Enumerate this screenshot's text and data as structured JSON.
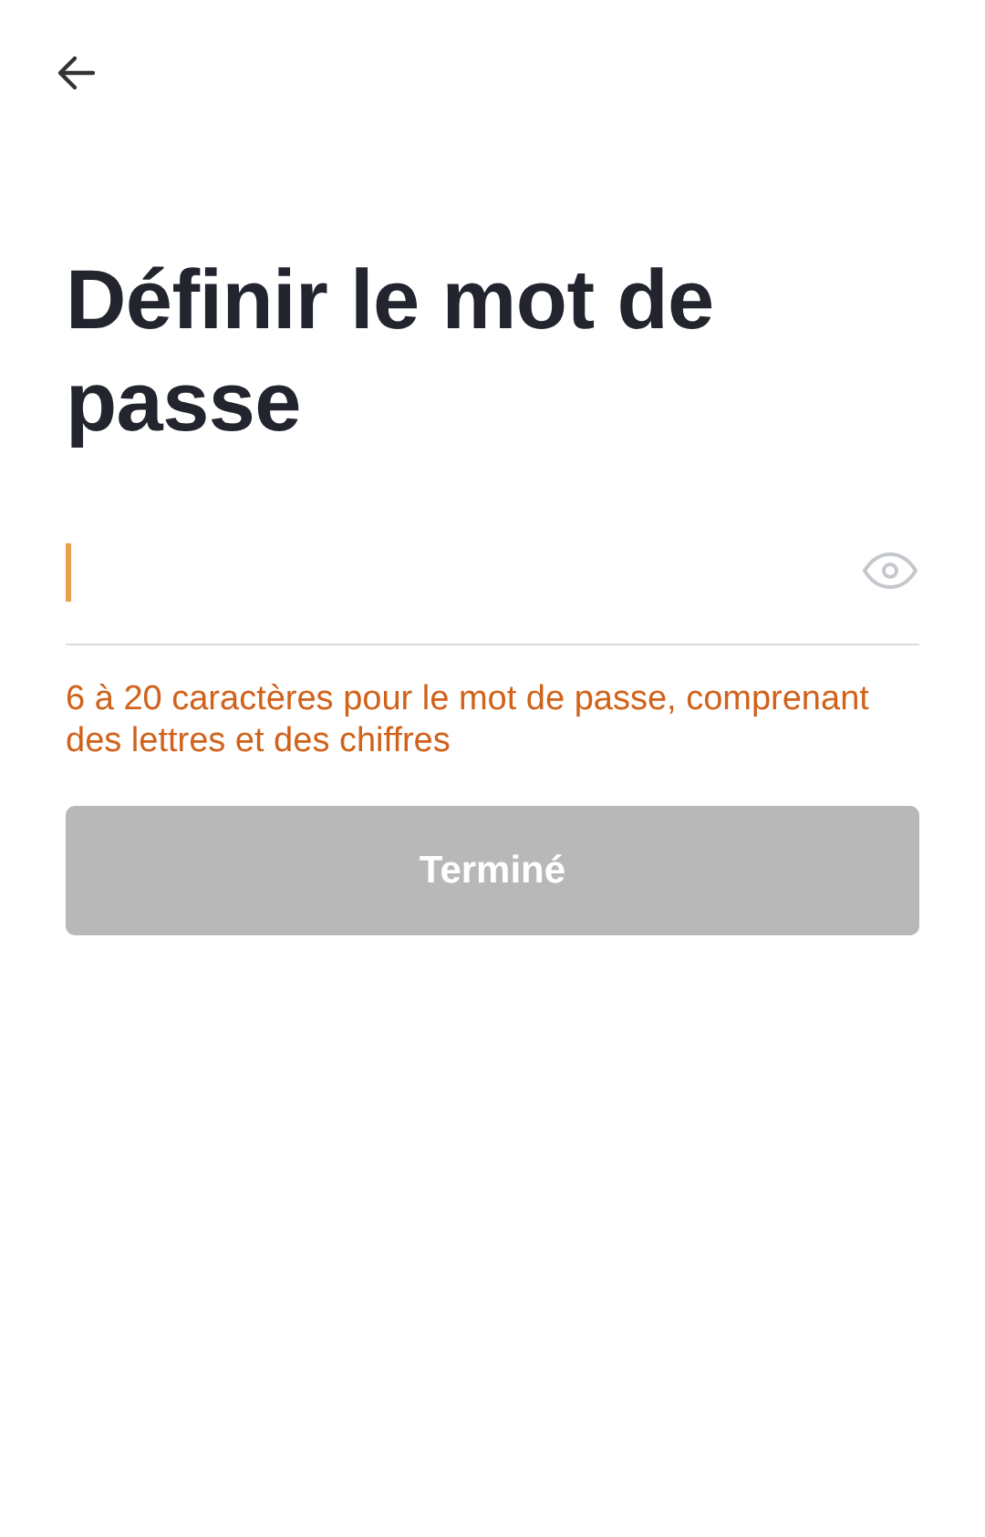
{
  "title": "Définir le mot de passe",
  "password_field": {
    "focused": true
  },
  "hint": "6 à 20 caractères pour le mot de passe, comprenant des lettres et des chiffres",
  "submit_button": {
    "label": "Terminé",
    "disabled": true
  }
}
